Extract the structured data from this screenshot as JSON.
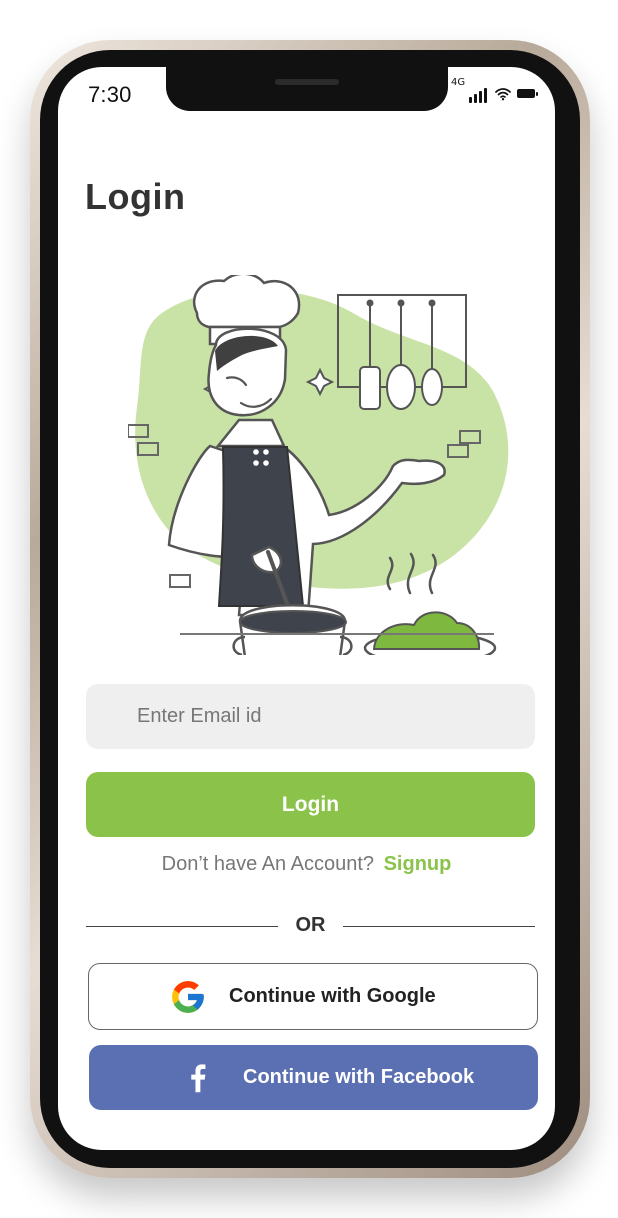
{
  "status_bar": {
    "time": "7:30",
    "network": "4G",
    "signal_bars": 4,
    "battery_level": 1
  },
  "page": {
    "title": "Login"
  },
  "form": {
    "email_placeholder": "Enter Email id",
    "login_label": "Login",
    "signup_prompt": "Don’t have An Account?",
    "signup_link": "Signup"
  },
  "divider": {
    "label": "OR"
  },
  "social": {
    "google_label": "Continue with Google",
    "facebook_label": "Continue with Facebook"
  },
  "colors": {
    "accent_green": "#8bc34a",
    "facebook_blue": "#5b70b2",
    "field_background": "#efefef"
  },
  "icons": [
    "signal-icon",
    "wifi-icon",
    "battery-icon",
    "google-icon",
    "facebook-icon"
  ]
}
